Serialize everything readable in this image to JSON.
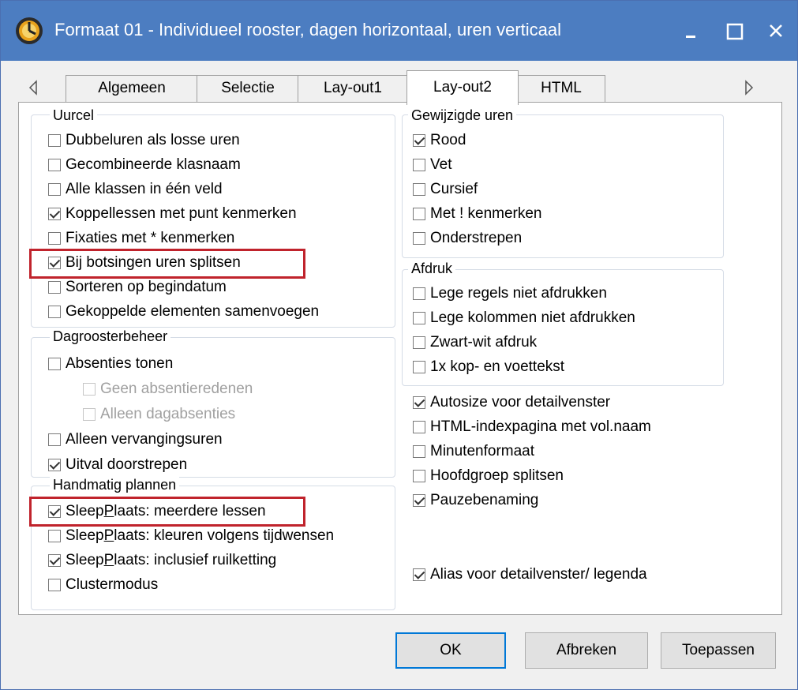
{
  "window": {
    "title": "Formaat 01 - Individueel rooster, dagen horizontaal, uren verticaal",
    "icon": "clock-icon",
    "controls": [
      "minimize-icon",
      "maximize-icon",
      "close-icon"
    ]
  },
  "tabs": {
    "scroll_left_icon": "triangle-left-icon",
    "scroll_right_icon": "triangle-right-icon",
    "items": [
      {
        "label": "Algemeen",
        "active": false
      },
      {
        "label": "Selectie",
        "active": false
      },
      {
        "label": "Lay-out1",
        "active": false
      },
      {
        "label": "Lay-out2",
        "active": true
      },
      {
        "label": "HTML",
        "active": false
      }
    ]
  },
  "uurcel": {
    "title": "Uurcel",
    "items": [
      {
        "label": "Dubbeluren als losse uren",
        "checked": false
      },
      {
        "label": "Gecombineerde klasnaam",
        "checked": false
      },
      {
        "label": "Alle klassen in één veld",
        "checked": false
      },
      {
        "label": "Koppellessen met punt kenmerken",
        "checked": true
      },
      {
        "label": "Fixaties met * kenmerken",
        "checked": false
      },
      {
        "label": "Bij botsingen uren splitsen",
        "checked": true
      },
      {
        "label": "Sorteren op begindatum",
        "checked": false
      },
      {
        "label": "Gekoppelde elementen samenvoegen",
        "checked": false
      }
    ]
  },
  "dagrooster": {
    "title": "Dagroosterbeheer",
    "items": [
      {
        "label": "Absenties tonen",
        "checked": false
      },
      {
        "label": "Geen absentieredenen",
        "checked": false,
        "disabled": true
      },
      {
        "label": "Alleen dagabsenties",
        "checked": false,
        "disabled": true
      },
      {
        "label": "Alleen vervangingsuren",
        "checked": false
      },
      {
        "label": "Uitval doorstrepen",
        "checked": true
      }
    ]
  },
  "handmatig": {
    "title": "Handmatig plannen",
    "items": [
      {
        "pre": "Sleep",
        "ul": "P",
        "post": "laats: meerdere lessen",
        "checked": true
      },
      {
        "pre": "Sleep",
        "ul": "P",
        "post": "laats: kleuren volgens tijdwensen",
        "checked": false
      },
      {
        "pre": "Sleep",
        "ul": "P",
        "post": "laats: inclusief ruilketting",
        "checked": true
      },
      {
        "pre": "Clustermodus",
        "ul": "",
        "post": "",
        "checked": false
      }
    ]
  },
  "gewijzigd": {
    "title": "Gewijzigde uren",
    "items": [
      {
        "label": "Rood",
        "checked": true
      },
      {
        "label": "Vet",
        "checked": false
      },
      {
        "label": "Cursief",
        "checked": false
      },
      {
        "label": "Met ! kenmerken",
        "checked": false
      },
      {
        "label": "Onderstrepen",
        "checked": false
      }
    ]
  },
  "afdruk": {
    "title": "Afdruk",
    "items": [
      {
        "label": "Lege regels niet afdrukken",
        "checked": false
      },
      {
        "label": "Lege kolommen niet afdrukken",
        "checked": false
      },
      {
        "label": "Zwart-wit afdruk",
        "checked": false
      },
      {
        "label": "1x kop- en voettekst",
        "checked": false
      }
    ]
  },
  "overig": {
    "items": [
      {
        "label": "Autosize voor detailvenster",
        "checked": true
      },
      {
        "label": "HTML-indexpagina met vol.naam",
        "checked": false
      },
      {
        "label": "Minutenformaat",
        "checked": false
      },
      {
        "label": "Hoofdgroep splitsen",
        "checked": false
      },
      {
        "label": "Pauzebenaming",
        "checked": true
      }
    ],
    "alias": {
      "label": "Alias voor detailvenster/ legenda",
      "checked": true
    }
  },
  "buttons": {
    "ok": "OK",
    "cancel": "Afbreken",
    "apply": "Toepassen"
  },
  "colors": {
    "titlebar": "#4c7dc1",
    "highlight": "#c0232c",
    "default_button_border": "#0078d7"
  }
}
